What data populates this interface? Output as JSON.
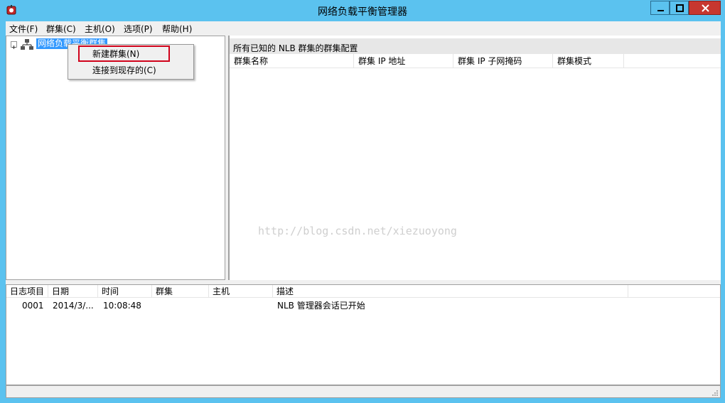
{
  "window": {
    "title": "网络负载平衡管理器"
  },
  "menu": {
    "items": [
      {
        "label": "文件(F)"
      },
      {
        "label": "群集(C)"
      },
      {
        "label": "主机(O)"
      },
      {
        "label": "选项(P)"
      },
      {
        "label": "帮助(H)"
      }
    ]
  },
  "tree": {
    "root_label": "网络负载平衡群集",
    "root_icon": "network-cluster-icon"
  },
  "context_menu": {
    "items": [
      {
        "label": "新建群集(N)"
      },
      {
        "label": "连接到现存的(C)"
      }
    ]
  },
  "cluster_panel": {
    "header": "所有已知的 NLB 群集的群集配置",
    "columns": [
      "群集名称",
      "群集 IP 地址",
      "群集 IP 子网掩码",
      "群集模式"
    ]
  },
  "watermark": "http://blog.csdn.net/xiezuoyong",
  "log_panel": {
    "columns": [
      "日志项目",
      "日期",
      "时间",
      "群集",
      "主机",
      "描述"
    ],
    "rows": [
      {
        "entry": "0001",
        "date": "2014/3/...",
        "time": "10:08:48",
        "cluster": "",
        "host": "",
        "description": "NLB 管理器会话已开始"
      }
    ]
  },
  "colors": {
    "titlebar": "#5bc2ef",
    "selection": "#3399ff",
    "close_button": "#c7372f",
    "highlight_box": "#d0021b"
  }
}
